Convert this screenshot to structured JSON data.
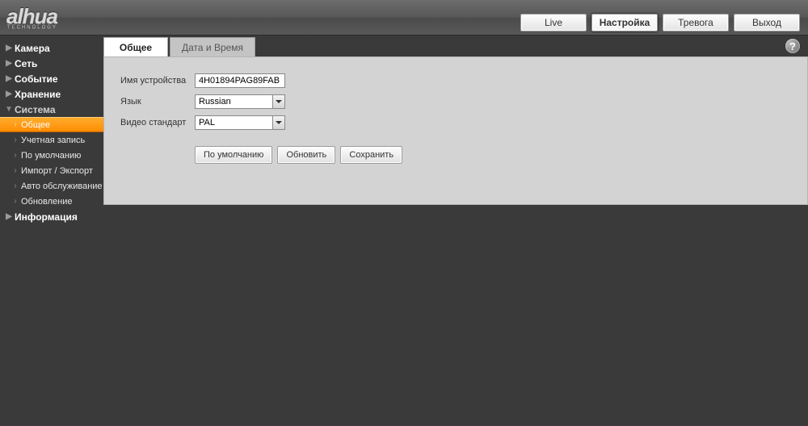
{
  "brand": {
    "name": "alhua",
    "sub": "TECHNOLOGY"
  },
  "topnav": {
    "live": "Live",
    "setup": "Настройка",
    "alarm": "Тревога",
    "logout": "Выход"
  },
  "sidebar": {
    "camera": "Камера",
    "network": "Сеть",
    "event": "Событие",
    "storage": "Хранение",
    "system": "Система",
    "system_children": {
      "general": "Общее",
      "account": "Учетная запись",
      "default": "По умолчанию",
      "impexp": "Импорт / Экспорт",
      "automaint": "Авто обслуживание",
      "upgrade": "Обновление"
    },
    "information": "Информация"
  },
  "tabs": {
    "general": "Общее",
    "datetime": "Дата и Время"
  },
  "form": {
    "device_name_label": "Имя устройства",
    "device_name_value": "4H01894PAG89FAB",
    "language_label": "Язык",
    "language_value": "Russian",
    "video_standard_label": "Видео стандарт",
    "video_standard_value": "PAL"
  },
  "buttons": {
    "default": "По умолчанию",
    "refresh": "Обновить",
    "save": "Сохранить"
  },
  "help_glyph": "?"
}
